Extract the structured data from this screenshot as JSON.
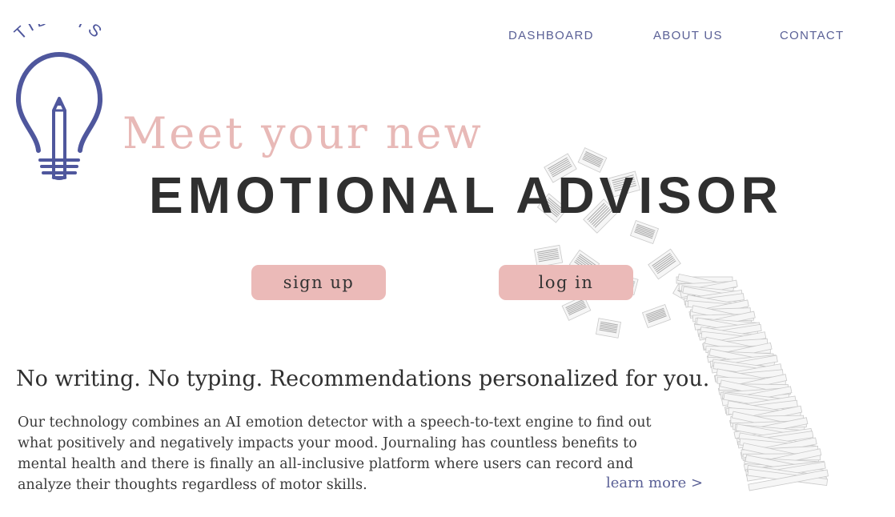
{
  "brand": {
    "logo_text": "TIDBITS",
    "accent_color": "#4f579d"
  },
  "nav": {
    "dashboard": "DASHBOARD",
    "about": "ABOUT US",
    "contact": "CONTACT"
  },
  "hero": {
    "kicker": "Meet your new",
    "title": "EMOTIONAL ADVISOR",
    "kicker_color": "#e8b9b7",
    "button_color": "#ebbab8"
  },
  "actions": {
    "signup_label": "sign up",
    "login_label": "log in"
  },
  "content": {
    "subheading": "No writing. No typing. Recommendations personalized for you.",
    "description_lines": [
      "Our technology combines an AI emotion detector with a speech-to-text engine to find out",
      "what positively and negatively impacts your mood. Journaling has countless benefits to",
      "mental health and there is finally an all-inclusive platform where users can record and",
      "analyze their thoughts regardless of motor skills."
    ],
    "learn_more": "learn more >"
  },
  "icons": {
    "logo": "lightbulb-pencil-icon",
    "illustration": "flying-papers-illustration"
  }
}
